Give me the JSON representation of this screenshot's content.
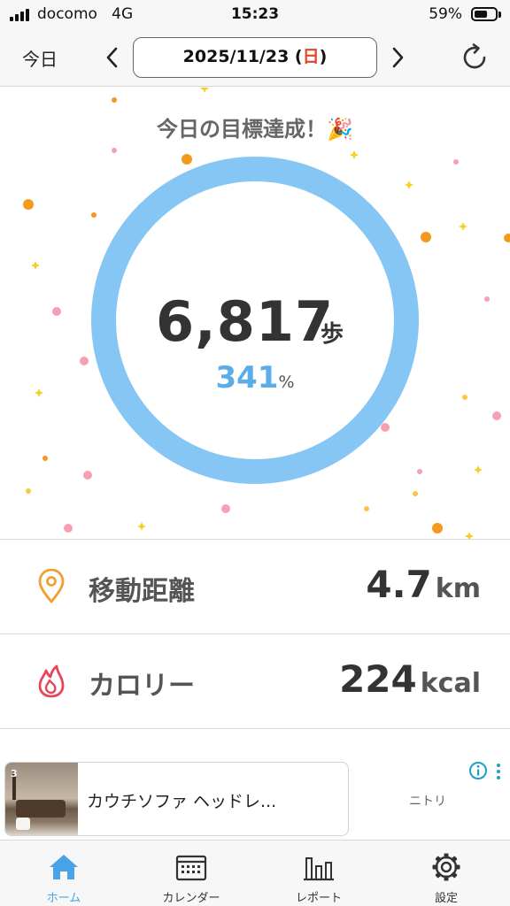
{
  "status_bar": {
    "carrier": "docomo",
    "network": "4G",
    "time": "15:23",
    "battery": "59%",
    "battery_level": 0.59
  },
  "header": {
    "today_label": "今日",
    "date": "2025/11/23 (",
    "day_of_week": "日",
    "date_close": ")",
    "prev_icon": "chevron-left-icon",
    "next_icon": "chevron-right-icon",
    "refresh_icon": "refresh-icon"
  },
  "goal": {
    "title": "今日の目標達成！🎉",
    "steps": "6,817",
    "steps_unit": "歩",
    "percent": "341",
    "percent_unit": "%",
    "progress_fraction": 1.0,
    "ring_color": "#86c6f5",
    "accent_color": "#5aaee8"
  },
  "stats": {
    "distance": {
      "label": "移動距離",
      "value": "4.7",
      "unit": "km",
      "icon": "map-pin-icon",
      "icon_color": "#f0a030"
    },
    "calorie": {
      "label": "カロリー",
      "value": "224",
      "unit": "kcal",
      "icon": "flame-icon",
      "icon_color": "#e8455a"
    }
  },
  "ad": {
    "title": "カウチソファ ヘッドレ...",
    "brand": "ニトリ",
    "image_badge": "3"
  },
  "tabs": [
    {
      "label": "ホーム",
      "icon": "home-icon",
      "active": true
    },
    {
      "label": "カレンダー",
      "icon": "calendar-icon",
      "active": false
    },
    {
      "label": "レポート",
      "icon": "bar-chart-icon",
      "active": false
    },
    {
      "label": "設定",
      "icon": "gear-icon",
      "active": false
    }
  ]
}
